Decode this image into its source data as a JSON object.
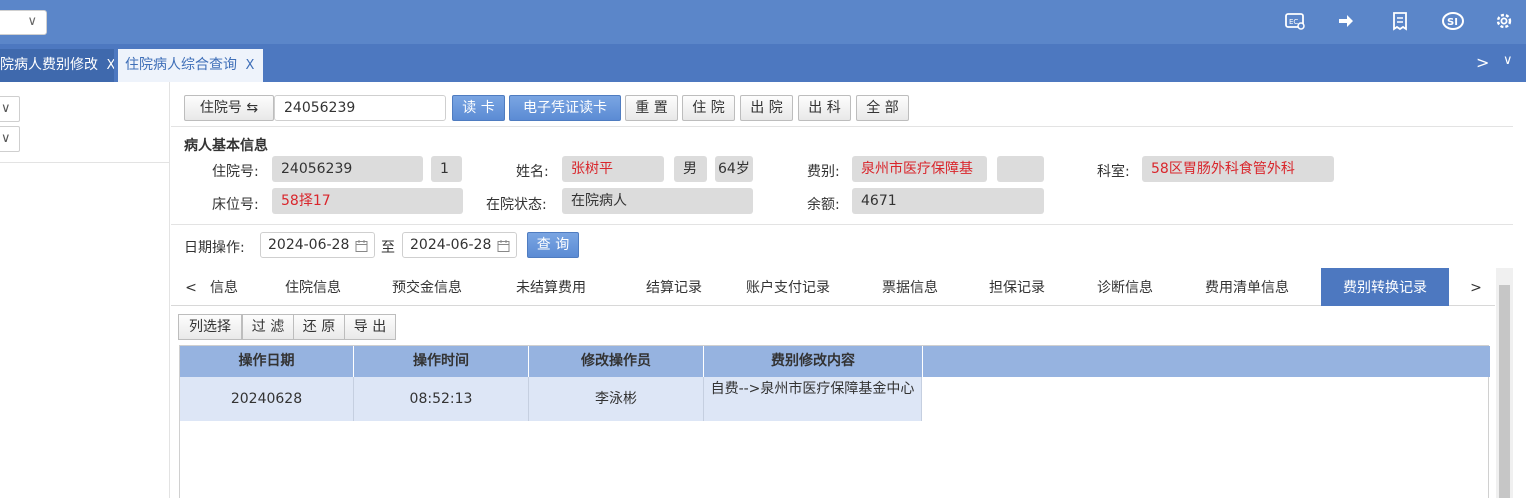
{
  "topbar": {
    "select_chevron": "∨",
    "icons": [
      "card-icon",
      "hand-icon",
      "receipt-icon",
      "si-icon",
      "gear-icon"
    ]
  },
  "tabs": [
    {
      "label": "院病人费别修改",
      "close": "X"
    },
    {
      "label": "住院病人综合查询",
      "close": "X"
    }
  ],
  "tabstrip_nav": {
    "next": ">",
    "more": "∨"
  },
  "left_panel": {
    "checks": [
      "∨",
      "∨"
    ]
  },
  "search": {
    "label": "住院号 ⇆",
    "value": "24056239",
    "buttons": [
      "读 卡",
      "电子凭证读卡",
      "重 置",
      "住 院",
      "出 院",
      "出 科",
      "全 部"
    ]
  },
  "patient": {
    "section_title": "病人基本信息",
    "admission_label": "住院号:",
    "admission_no": "24056239",
    "admission_count": "1",
    "name_label": "姓名:",
    "name": "张树平",
    "gender": "男",
    "age": "64岁",
    "fee_label": "费别:",
    "fee_type": "泉州市医疗保障基",
    "fee_extra": "",
    "dept_label": "科室:",
    "dept": "58区胃肠外科食管外科",
    "bed_label": "床位号:",
    "bed": "58择17",
    "status_label": "在院状态:",
    "status": "在院病人",
    "balance_label": "余额:",
    "balance": "4671"
  },
  "date_filter": {
    "label": "日期操作:",
    "from": "2024-06-28",
    "to_label": "至",
    "to": "2024-06-28",
    "query_button": "查 询"
  },
  "subtabs": {
    "prev": "<",
    "next": ">",
    "items": [
      "信息",
      "住院信息",
      "预交金信息",
      "未结算费用",
      "结算记录",
      "账户支付记录",
      "票据信息",
      "担保记录",
      "诊断信息",
      "费用清单信息",
      "费别转换记录"
    ],
    "active": "费别转换记录"
  },
  "toolbar": [
    "列选择",
    "过 滤",
    "还 原",
    "导 出"
  ],
  "table": {
    "columns": [
      "操作日期",
      "操作时间",
      "修改操作员",
      "费别修改内容"
    ],
    "rows": [
      {
        "date": "20240628",
        "time": "08:52:13",
        "operator": "李泳彬",
        "content": "自费-->泉州市医疗保障基金中心"
      }
    ]
  }
}
